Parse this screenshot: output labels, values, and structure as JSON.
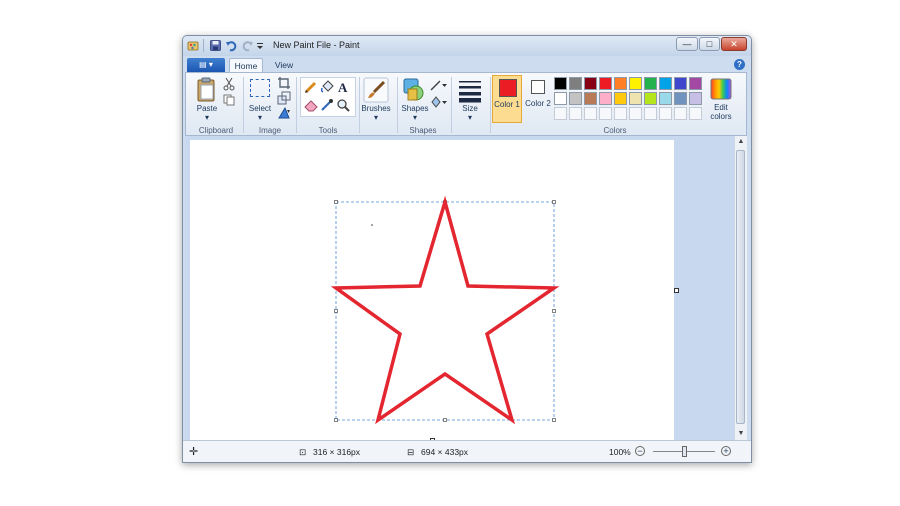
{
  "window": {
    "title": "New Paint File - Paint"
  },
  "tabs": [
    {
      "label": "Home",
      "active": true
    },
    {
      "label": "View",
      "active": false
    }
  ],
  "groups": {
    "clipboard": {
      "label": "Clipboard",
      "paste": "Paste"
    },
    "image": {
      "label": "Image",
      "select": "Select"
    },
    "tools": {
      "label": "Tools"
    },
    "brushes": {
      "label": "Brushes"
    },
    "shapes": {
      "label": "Shapes",
      "shapes_button": "Shapes"
    },
    "size": {
      "label": "Size"
    },
    "colors": {
      "label": "Colors",
      "color1": "Color 1",
      "color2": "Color 2",
      "edit": "Edit colors",
      "color1_value": "#ec1c24",
      "color2_value": "#ffffff",
      "palette_row1": [
        "#000000",
        "#7f7f7f",
        "#880015",
        "#ed1c24",
        "#ff7f27",
        "#fff200",
        "#22b14c",
        "#00a2e8",
        "#3f48cc",
        "#a349a4"
      ],
      "palette_row2": [
        "#ffffff",
        "#c3c3c3",
        "#b97a57",
        "#ffaec9",
        "#ffc90e",
        "#efe4b0",
        "#b5e61d",
        "#99d9ea",
        "#7092be",
        "#c8bfe7"
      ]
    }
  },
  "status": {
    "selection_size": "316 × 316px",
    "canvas_size": "694 × 433px",
    "zoom": "100%",
    "zoom_level": 0.5
  },
  "icons": {
    "file_menu": "file-menu-icon",
    "save": "save-icon",
    "undo": "undo-icon",
    "redo": "redo-icon",
    "help": "help-icon"
  },
  "help_label": "?",
  "file_menu_glyph": "▤ ▾"
}
